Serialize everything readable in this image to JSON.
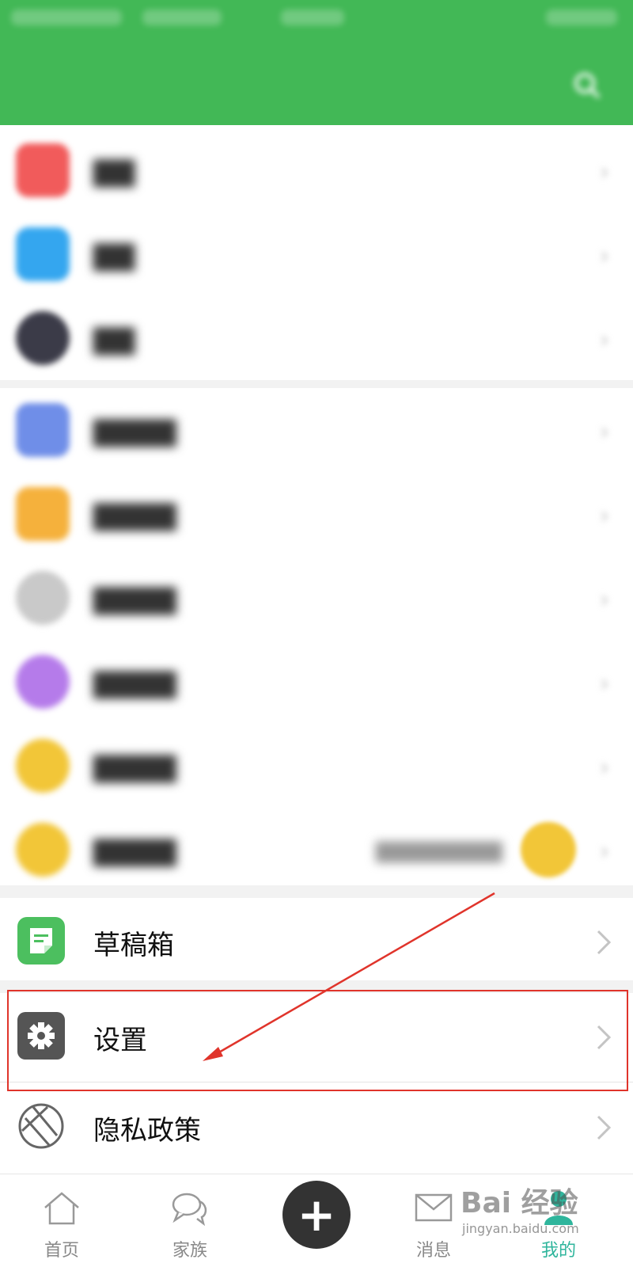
{
  "header": {
    "title": "",
    "search_icon": "search-icon",
    "color": "#42b856"
  },
  "blurred_rows": [
    {
      "icon_color": "#f15b5b",
      "shape": "square"
    },
    {
      "icon_color": "#34a6ef",
      "shape": "square"
    },
    {
      "icon_color": "#3b3b48",
      "shape": "round"
    },
    {
      "icon_color": "#6f8ee8",
      "shape": "square"
    },
    {
      "icon_color": "#f5b13c",
      "shape": "square"
    },
    {
      "icon_color": "#c9c9c9",
      "shape": "round"
    },
    {
      "icon_color": "#b57bea",
      "shape": "round"
    },
    {
      "icon_color": "#f2c638",
      "shape": "round"
    },
    {
      "icon_color": "#f2c638",
      "shape": "round"
    }
  ],
  "menu": {
    "drafts": {
      "label": "草稿箱",
      "icon": "draft-icon",
      "icon_color": "#4cbf5f"
    },
    "settings": {
      "label": "设置",
      "icon": "gear-icon",
      "icon_color": "#555555"
    },
    "privacy": {
      "label": "隐私政策",
      "icon": "privacy-icon",
      "icon_color": "#666666"
    }
  },
  "annotation": {
    "box_color": "#e0342b"
  },
  "bottom_nav": {
    "home": {
      "label": "首页",
      "icon": "home-icon"
    },
    "family": {
      "label": "家族",
      "icon": "chat-bubbles-icon"
    },
    "publish": {
      "label": "+",
      "icon": "plus-icon"
    },
    "messages": {
      "label": "消息",
      "icon": "mail-icon"
    },
    "me": {
      "label": "我的",
      "icon": "person-icon",
      "active_color": "#2fb59c"
    }
  },
  "watermark": {
    "top": "Bai 经验",
    "bottom": "jingyan.baidu.com"
  }
}
